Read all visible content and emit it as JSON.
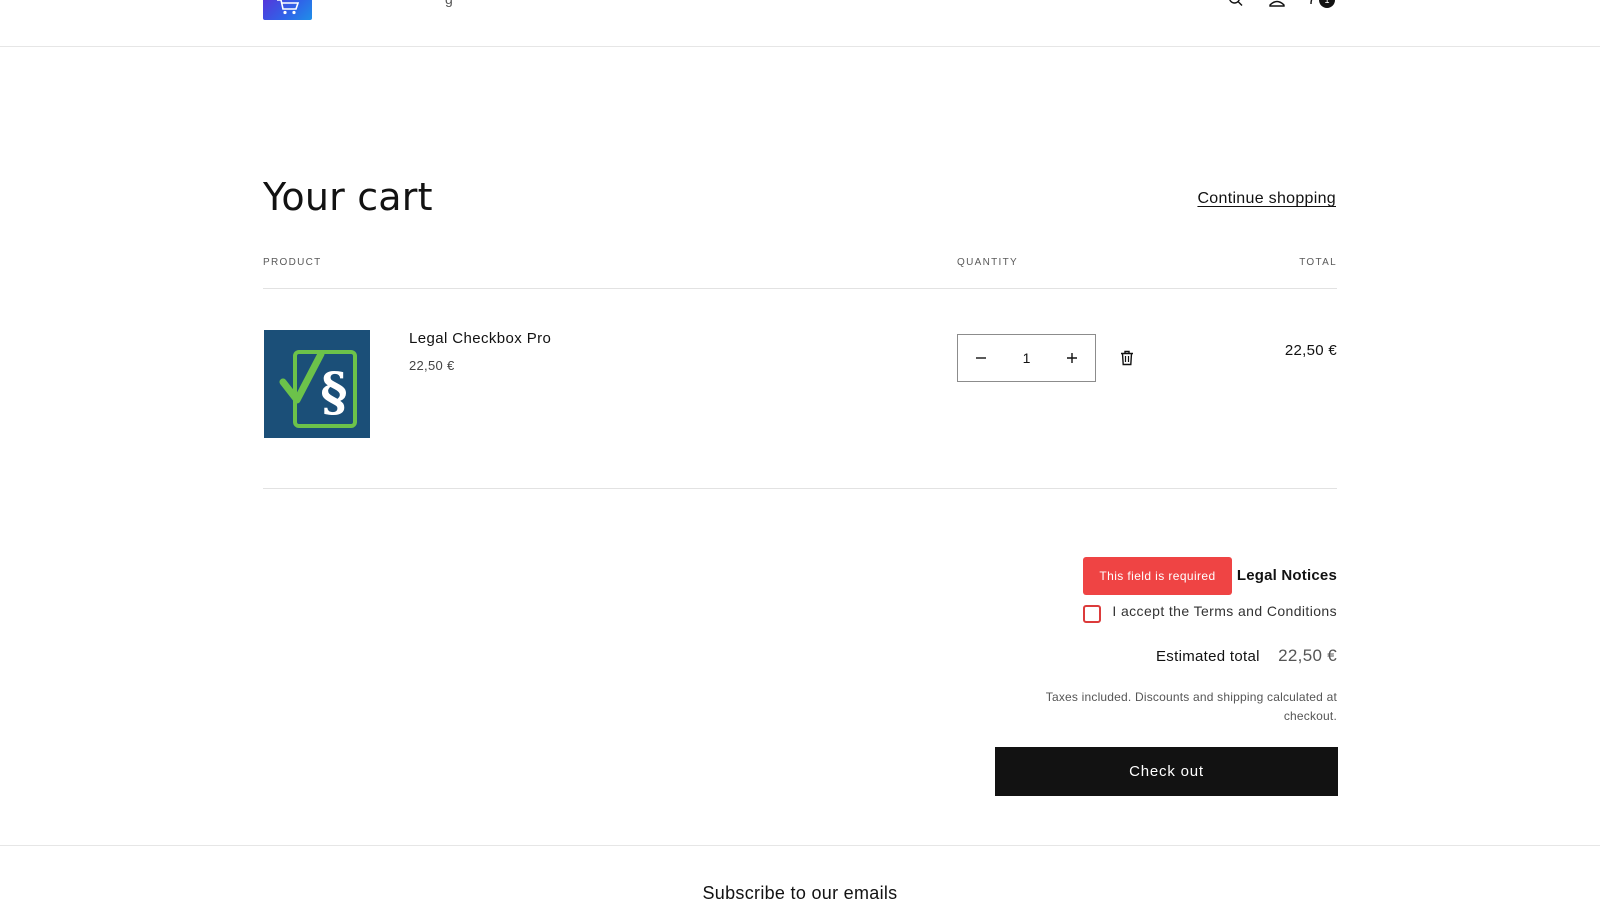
{
  "header": {
    "nav_fragment": "g",
    "cart_count": "1"
  },
  "cart": {
    "title": "Your cart",
    "continue_label": "Continue shopping",
    "columns": {
      "product": "PRODUCT",
      "quantity": "QUANTITY",
      "total": "TOTAL"
    },
    "items": [
      {
        "name": "Legal Checkbox Pro",
        "unit_price": "22,50 €",
        "quantity": "1",
        "line_total": "22,50 €"
      }
    ]
  },
  "legal": {
    "error": "This field is required",
    "heading": "Legal Notices",
    "terms_label": "I accept the Terms and Conditions",
    "terms_checked": false
  },
  "summary": {
    "estimated_label": "Estimated total",
    "estimated_value": "22,50 €",
    "tax_note": "Taxes included. Discounts and shipping calculated at checkout.",
    "checkout_label": "Check out"
  },
  "footer": {
    "subscribe_title": "Subscribe to our emails"
  },
  "colors": {
    "error": "#ef4444",
    "button": "#121212",
    "product_bg": "#1b4f78",
    "product_check": "#6cc24a"
  },
  "icons": {
    "logo": "shopping-cart-icon",
    "search": "search-icon",
    "account": "account-icon",
    "cart": "cart-bubble-icon",
    "minus": "minus-icon",
    "plus": "plus-icon",
    "remove": "trash-icon"
  }
}
